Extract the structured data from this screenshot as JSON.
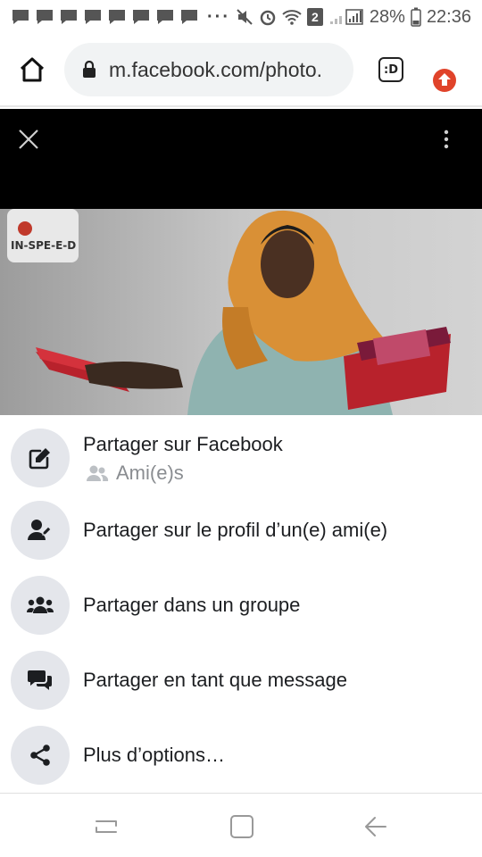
{
  "status_bar": {
    "battery_percent": "28%",
    "time": "22:36",
    "notification_count": "2",
    "icons": [
      "message-icon",
      "message-icon",
      "message-icon",
      "message-icon",
      "message-icon",
      "message-icon",
      "message-icon",
      "message-icon",
      "more-notifications-icon",
      "mute-icon",
      "alarm-icon",
      "wifi-icon",
      "sim2-icon",
      "signal-icon",
      "battery-icon"
    ]
  },
  "browser": {
    "url": "m.facebook.com/photo.",
    "tab_count": ":D",
    "icons": [
      "home-icon",
      "lock-icon",
      "tab-switcher-icon",
      "update-icon"
    ]
  },
  "viewer": {
    "icons": [
      "close-icon",
      "more-vertical-icon"
    ],
    "photo_description_logo": "IN-SPE-E-D"
  },
  "share_sheet": {
    "items": [
      {
        "label": "Partager sur Facebook",
        "sublabel": "Ami(e)s",
        "icon": "edit-icon"
      },
      {
        "label": "Partager sur le profil d’un(e) ami(e)",
        "icon": "friend-share-icon"
      },
      {
        "label": "Partager dans un groupe",
        "icon": "group-icon"
      },
      {
        "label": "Partager en tant que message",
        "icon": "messages-icon"
      },
      {
        "label": "Plus d’options…",
        "icon": "share-icon"
      }
    ]
  },
  "nav_bar": {
    "icons": [
      "recents-icon",
      "home-square-icon",
      "back-icon"
    ]
  },
  "colors": {
    "accent_red": "#e0432a",
    "circle_bg": "#e4e6eb",
    "sublabel_gray": "#8a8d91"
  }
}
